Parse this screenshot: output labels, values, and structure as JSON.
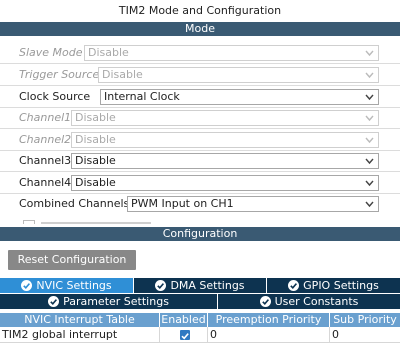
{
  "window": {
    "title": "TIM2 Mode and Configuration"
  },
  "sections": {
    "mode": "Mode",
    "configuration": "Configuration"
  },
  "mode": {
    "rows": [
      {
        "label": "Slave Mode",
        "value": "Disable",
        "enabled": false
      },
      {
        "label": "Trigger Source",
        "value": "Disable",
        "enabled": false
      },
      {
        "label": "Clock Source",
        "value": "Internal Clock",
        "enabled": true
      },
      {
        "label": "Channel1",
        "value": "Disable",
        "enabled": false
      },
      {
        "label": "Channel2",
        "value": "Disable",
        "enabled": false
      },
      {
        "label": "Channel3",
        "value": "Disable",
        "enabled": true
      },
      {
        "label": "Channel4",
        "value": "Disable",
        "enabled": true
      },
      {
        "label": "Combined Channels",
        "value": "PWM Input on CH1",
        "enabled": true
      }
    ]
  },
  "config": {
    "reset_button": "Reset Configuration",
    "tabs_row1": [
      "NVIC Settings",
      "DMA Settings",
      "GPIO Settings"
    ],
    "tabs_row2": [
      "Parameter Settings",
      "User Constants"
    ],
    "active_tab": "NVIC Settings",
    "table": {
      "headers": [
        "NVIC Interrupt Table",
        "Enabled",
        "Preemption Priority",
        "Sub Priority"
      ],
      "rows": [
        {
          "name": "TIM2 global interrupt",
          "enabled": true,
          "preemption": "0",
          "sub": "0"
        }
      ]
    }
  },
  "colors": {
    "section_bar": "#3a5a73",
    "tab_active": "#2f8fd6",
    "tab_inactive": "#0d3350",
    "table_header": "#6aa0cf"
  }
}
